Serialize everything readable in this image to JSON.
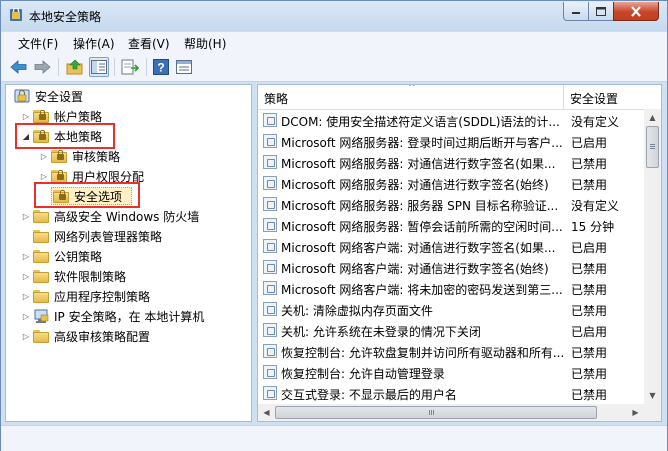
{
  "window": {
    "title": "本地安全策略"
  },
  "menu": [
    {
      "label": "文件(F)"
    },
    {
      "label": "操作(A)"
    },
    {
      "label": "查看(V)"
    },
    {
      "label": "帮助(H)"
    }
  ],
  "toolbar": {
    "buttons": [
      {
        "icon": "back-arrow-icon"
      },
      {
        "icon": "forward-arrow-icon"
      },
      {
        "icon": "up-folder-icon"
      },
      {
        "icon": "show-hide-tree-icon",
        "pressed": true
      },
      {
        "icon": "export-list-icon"
      },
      {
        "icon": "help-icon"
      },
      {
        "icon": "properties-icon"
      }
    ]
  },
  "tree": {
    "root": "安全设置",
    "items": [
      {
        "label": "帐户策略",
        "expanded": false
      },
      {
        "label": "本地策略",
        "expanded": true,
        "highlighted": true
      },
      {
        "label": "审核策略",
        "expanded": false
      },
      {
        "label": "用户权限分配",
        "expanded": false
      },
      {
        "label": "安全选项",
        "selected": true,
        "highlighted": true
      },
      {
        "label": "高级安全 Windows 防火墙",
        "expanded": false
      },
      {
        "label": "网络列表管理器策略"
      },
      {
        "label": "公钥策略",
        "expanded": false
      },
      {
        "label": "软件限制策略",
        "expanded": false
      },
      {
        "label": "应用程序控制策略",
        "expanded": false
      },
      {
        "label": "IP 安全策略，在 本地计算机",
        "expanded": false
      },
      {
        "label": "高级审核策略配置",
        "expanded": false
      }
    ]
  },
  "list": {
    "columns": [
      "策略",
      "安全设置"
    ],
    "rows": [
      {
        "policy": "DCOM: 使用安全描述符定义语言(SDDL)语法的计...",
        "setting": "没有定义"
      },
      {
        "policy": "Microsoft 网络服务器: 登录时间过期后断开与客户...",
        "setting": "已启用"
      },
      {
        "policy": "Microsoft 网络服务器: 对通信进行数字签名(如果...",
        "setting": "已禁用"
      },
      {
        "policy": "Microsoft 网络服务器: 对通信进行数字签名(始终)",
        "setting": "已禁用"
      },
      {
        "policy": "Microsoft 网络服务器: 服务器 SPN 目标名称验证...",
        "setting": "没有定义"
      },
      {
        "policy": "Microsoft 网络服务器: 暂停会话前所需的空闲时间...",
        "setting": "15 分钟"
      },
      {
        "policy": "Microsoft 网络客户端: 对通信进行数字签名(如果...",
        "setting": "已启用"
      },
      {
        "policy": "Microsoft 网络客户端: 对通信进行数字签名(始终)",
        "setting": "已禁用"
      },
      {
        "policy": "Microsoft 网络客户端: 将未加密的密码发送到第三...",
        "setting": "已禁用"
      },
      {
        "policy": "关机: 清除虚拟内存页面文件",
        "setting": "已禁用"
      },
      {
        "policy": "关机: 允许系统在未登录的情况下关闭",
        "setting": "已启用"
      },
      {
        "policy": "恢复控制台: 允许软盘复制并访问所有驱动器和所有...",
        "setting": "已禁用"
      },
      {
        "policy": "恢复控制台: 允许自动管理登录",
        "setting": "已禁用"
      },
      {
        "policy": "交互式登录: 不显示最后的用户名",
        "setting": "已禁用"
      }
    ]
  },
  "colors": {
    "highlight_border": "#e8312d",
    "selection_fill": "#fff1c4"
  }
}
